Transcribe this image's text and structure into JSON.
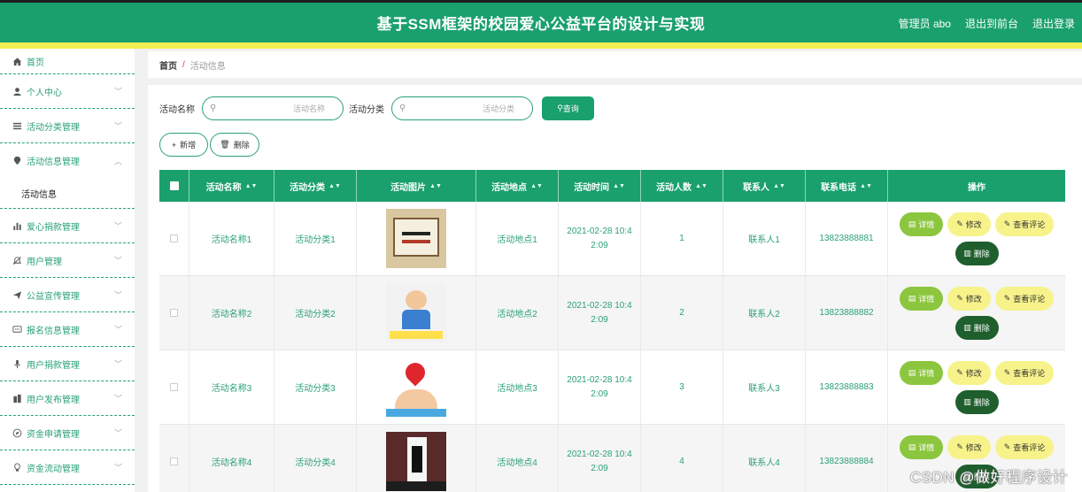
{
  "header": {
    "title": "基于SSM框架的校园爱心公益平台的设计与实现",
    "admin_label": "管理员 abo",
    "back_front": "退出到前台",
    "logout": "退出登录"
  },
  "colors": {
    "primary": "#1aa06d",
    "accent_yellow": "#f3ee54",
    "detail_btn": "#8cc63f",
    "edit_btn": "#f7f38a",
    "delete_btn": "#1f5f2d"
  },
  "sidebar": {
    "items": [
      {
        "label": "首页",
        "icon": "home-icon"
      },
      {
        "label": "个人中心",
        "icon": "user-icon"
      },
      {
        "label": "活动分类管理",
        "icon": "list-icon"
      },
      {
        "label": "活动信息管理",
        "icon": "location-pin-icon"
      },
      {
        "label": "活动信息",
        "icon": ""
      },
      {
        "label": "爱心捐款管理",
        "icon": "bar-chart-icon"
      },
      {
        "label": "用户管理",
        "icon": "bell-off-icon"
      },
      {
        "label": "公益宣传管理",
        "icon": "send-icon"
      },
      {
        "label": "报名信息管理",
        "icon": "chat-icon"
      },
      {
        "label": "用户捐款管理",
        "icon": "microphone-icon"
      },
      {
        "label": "用户发布管理",
        "icon": "building-icon"
      },
      {
        "label": "资金申请管理",
        "icon": "compass-icon"
      },
      {
        "label": "资金流动管理",
        "icon": "badge-icon"
      }
    ]
  },
  "breadcrumb": {
    "home": "首页",
    "separator": "/",
    "current": "活动信息"
  },
  "search": {
    "name_label": "活动名称",
    "name_placeholder": "活动名称",
    "category_label": "活动分类",
    "category_placeholder": "活动分类",
    "button": "查询"
  },
  "actions": {
    "add": "新增",
    "delete": "删除"
  },
  "table": {
    "columns": [
      "活动名称",
      "活动分类",
      "活动图片",
      "活动地点",
      "活动时间",
      "活动人数",
      "联系人",
      "联系电话",
      "操作"
    ],
    "rows": [
      {
        "name": "活动名称1",
        "category": "活动分类1",
        "place": "活动地点1",
        "time_line1": "2021-02-28 10:4",
        "time_line2": "2:09",
        "count": "1",
        "contact": "联系人1",
        "phone": "13823888881"
      },
      {
        "name": "活动名称2",
        "category": "活动分类2",
        "place": "活动地点2",
        "time_line1": "2021-02-28 10:4",
        "time_line2": "2:09",
        "count": "2",
        "contact": "联系人2",
        "phone": "13823888882"
      },
      {
        "name": "活动名称3",
        "category": "活动分类3",
        "place": "活动地点3",
        "time_line1": "2021-02-28 10:4",
        "time_line2": "2:09",
        "count": "3",
        "contact": "联系人3",
        "phone": "13823888883"
      },
      {
        "name": "活动名称4",
        "category": "活动分类4",
        "place": "活动地点4",
        "time_line1": "2021-02-28 10:4",
        "time_line2": "2:09",
        "count": "4",
        "contact": "联系人4",
        "phone": "13823888884"
      }
    ],
    "ops": {
      "detail": "详情",
      "edit": "修改",
      "review": "查看评论",
      "delete": "删除"
    }
  },
  "watermark": "CSDN @做好程序设计"
}
